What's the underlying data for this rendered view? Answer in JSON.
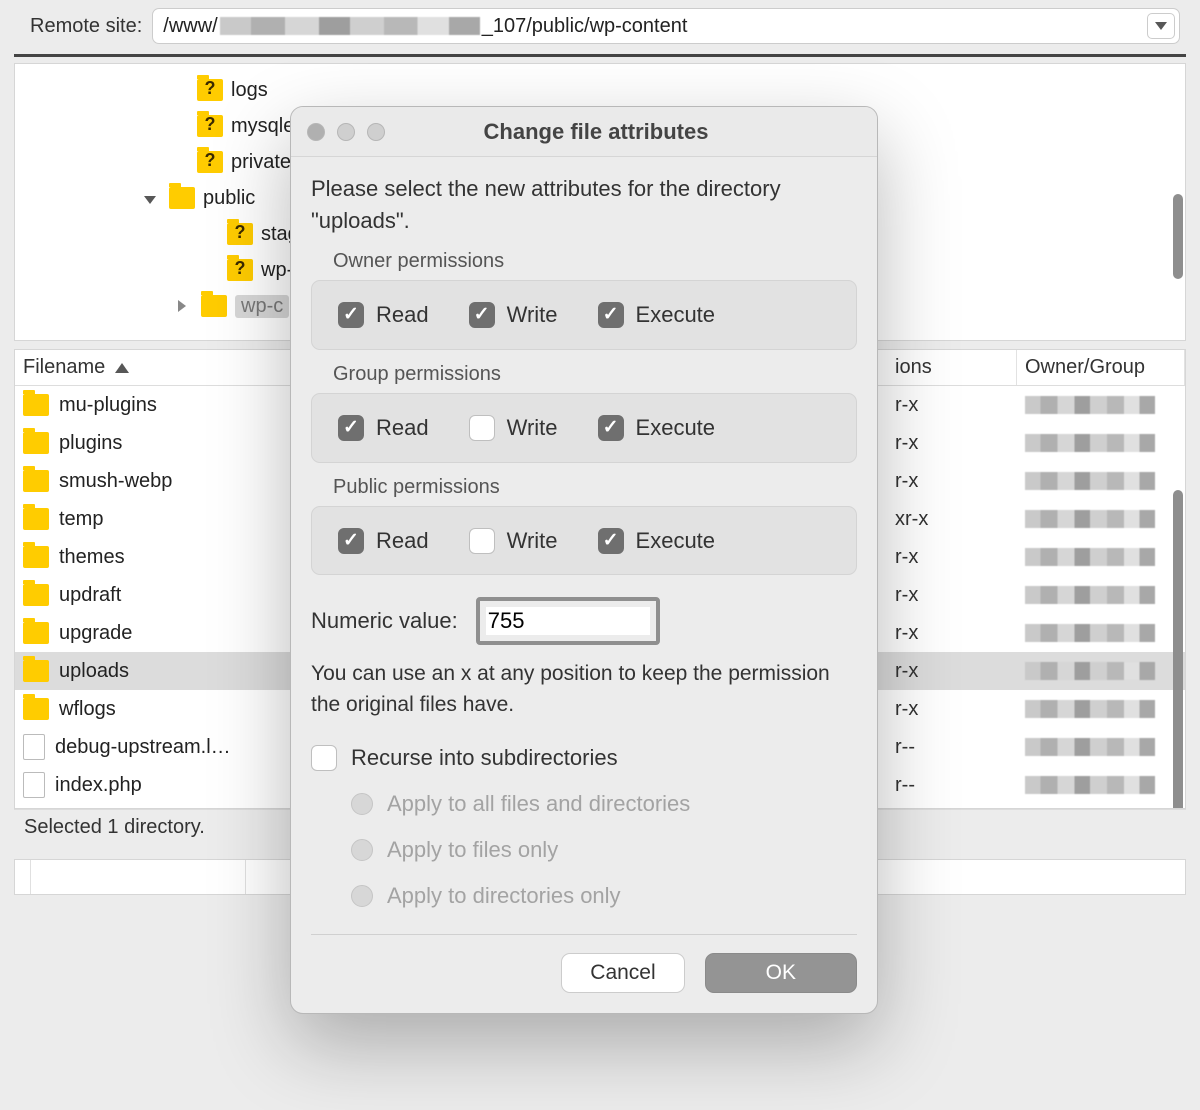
{
  "remote": {
    "label": "Remote site:",
    "path_prefix": "/www/",
    "path_suffix": "_107/public/wp-content"
  },
  "tree": {
    "items": [
      {
        "name": "logs",
        "icon": "folder-question"
      },
      {
        "name": "mysqled",
        "icon": "folder-question"
      },
      {
        "name": "private",
        "icon": "folder-question"
      },
      {
        "name": "public",
        "icon": "folder",
        "expanded": true,
        "children": [
          {
            "name": "stagi",
            "icon": "folder-question"
          },
          {
            "name": "wp-a",
            "icon": "folder-question"
          },
          {
            "name": "wp-c",
            "icon": "folder",
            "selected": true,
            "hasChildren": true
          }
        ]
      }
    ]
  },
  "list": {
    "columns": {
      "filename": "Filename",
      "permissions": "ions",
      "owner": "Owner/Group"
    },
    "rows": [
      {
        "name": "mu-plugins",
        "icon": "folder",
        "perm": "r-x"
      },
      {
        "name": "plugins",
        "icon": "folder",
        "perm": "r-x"
      },
      {
        "name": "smush-webp",
        "icon": "folder",
        "perm": "r-x"
      },
      {
        "name": "temp",
        "icon": "folder",
        "perm": "xr-x"
      },
      {
        "name": "themes",
        "icon": "folder",
        "perm": "r-x"
      },
      {
        "name": "updraft",
        "icon": "folder",
        "perm": "r-x"
      },
      {
        "name": "upgrade",
        "icon": "folder",
        "perm": "r-x"
      },
      {
        "name": "uploads",
        "icon": "folder",
        "perm": "r-x",
        "selected": true
      },
      {
        "name": "wflogs",
        "icon": "folder",
        "perm": "r-x"
      },
      {
        "name": "debug-upstream.l…",
        "icon": "file",
        "perm": "r--"
      },
      {
        "name": "index.php",
        "icon": "file",
        "perm": "r--"
      }
    ]
  },
  "status": "Selected 1 directory.",
  "dialog": {
    "title": "Change file attributes",
    "intro": "Please select the new attributes for the directory \"uploads\".",
    "owner_label": "Owner permissions",
    "group_label": "Group permissions",
    "public_label": "Public permissions",
    "read": "Read",
    "write": "Write",
    "execute": "Execute",
    "owner": {
      "read": true,
      "write": true,
      "execute": true
    },
    "group": {
      "read": true,
      "write": false,
      "execute": true
    },
    "public": {
      "read": true,
      "write": false,
      "execute": true
    },
    "numeric_label": "Numeric value:",
    "numeric_value": "755",
    "hint": "You can use an x at any position to keep the permission the original files have.",
    "recurse_label": "Recurse into subdirectories",
    "recurse": false,
    "radios": [
      "Apply to all files and directories",
      "Apply to files only",
      "Apply to directories only"
    ],
    "cancel": "Cancel",
    "ok": "OK"
  }
}
